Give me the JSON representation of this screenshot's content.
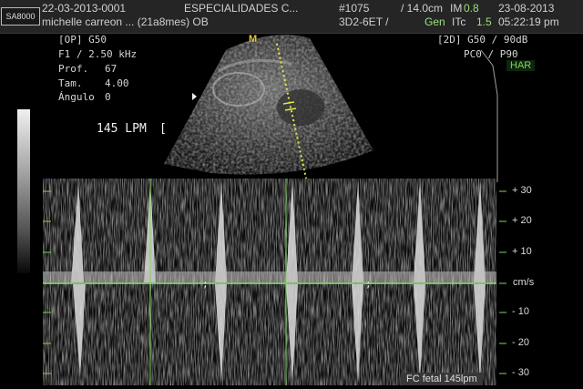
{
  "header": {
    "logo": "SA8000",
    "patient_id": "22-03-2013-0001",
    "patient_name": "michelle carreon ... (21a8mes) OB",
    "institution": "ESPECIALIDADES C...",
    "exam_number": "#1075",
    "depth_label": "/ 14.0cm",
    "mi_label": "IM",
    "mi_value": "0.8",
    "date": "23-08-2013",
    "probe": "3D2-6ET /",
    "gen_label": "Gen",
    "ti_label": "ITc",
    "ti_value": "1.5",
    "time": "05:22:19 pm"
  },
  "left_params": {
    "op": "[OP]  G50",
    "freq": "F1 / 2.50 kHz",
    "depth_label": "Prof.",
    "depth_value": "67",
    "size_label": "Tam.",
    "size_value": "4.00",
    "angle_label": "Ángulo",
    "angle_value": "0"
  },
  "right_params": {
    "mode": "[2D] G50 / 90dB",
    "persistence": "PC0 / P90",
    "har": "HAR"
  },
  "heart_rate": "145 LPM",
  "sector_marker": "M",
  "velocity_scale": {
    "labels": [
      "+ 30",
      "+ 20",
      "+ 10",
      "cm/s",
      "- 10",
      "- 20",
      "- 30"
    ],
    "unit": "cm/s"
  },
  "fetal_hr_box": "FC fetal 145lpm",
  "colors": {
    "accent_green": "#7fd35c",
    "sample_gate": "#e6e64a",
    "background": "#000000"
  }
}
